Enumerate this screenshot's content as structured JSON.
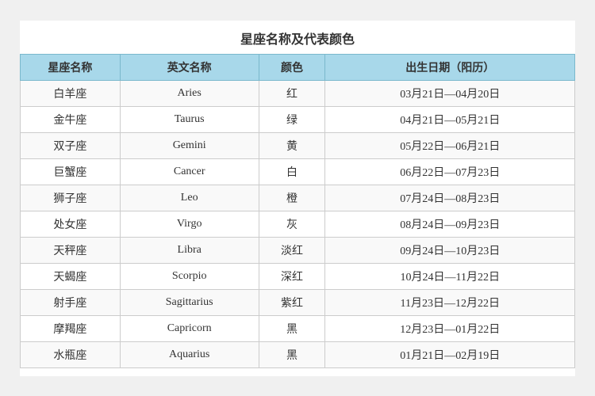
{
  "title": "星座名称及代表颜色",
  "headers": {
    "col1": "星座名称",
    "col2": "英文名称",
    "col3": "颜色",
    "col4": "出生日期（阳历）"
  },
  "rows": [
    {
      "cn": "白羊座",
      "en": "Aries",
      "color": "红",
      "date": "03月21日—04月20日"
    },
    {
      "cn": "金牛座",
      "en": "Taurus",
      "color": "绿",
      "date": "04月21日—05月21日"
    },
    {
      "cn": "双子座",
      "en": "Gemini",
      "color": "黄",
      "date": "05月22日—06月21日"
    },
    {
      "cn": "巨蟹座",
      "en": "Cancer",
      "color": "白",
      "date": "06月22日—07月23日"
    },
    {
      "cn": "狮子座",
      "en": "Leo",
      "color": "橙",
      "date": "07月24日—08月23日"
    },
    {
      "cn": "处女座",
      "en": "Virgo",
      "color": "灰",
      "date": "08月24日—09月23日"
    },
    {
      "cn": "天秤座",
      "en": "Libra",
      "color": "淡红",
      "date": "09月24日—10月23日"
    },
    {
      "cn": "天蝎座",
      "en": "Scorpio",
      "color": "深红",
      "date": "10月24日—11月22日"
    },
    {
      "cn": "射手座",
      "en": "Sagittarius",
      "color": "紫红",
      "date": "11月23日—12月22日"
    },
    {
      "cn": "摩羯座",
      "en": "Capricorn",
      "color": "黑",
      "date": "12月23日—01月22日"
    },
    {
      "cn": "水瓶座",
      "en": "Aquarius",
      "color": "黑",
      "date": "01月21日—02月19日"
    }
  ]
}
